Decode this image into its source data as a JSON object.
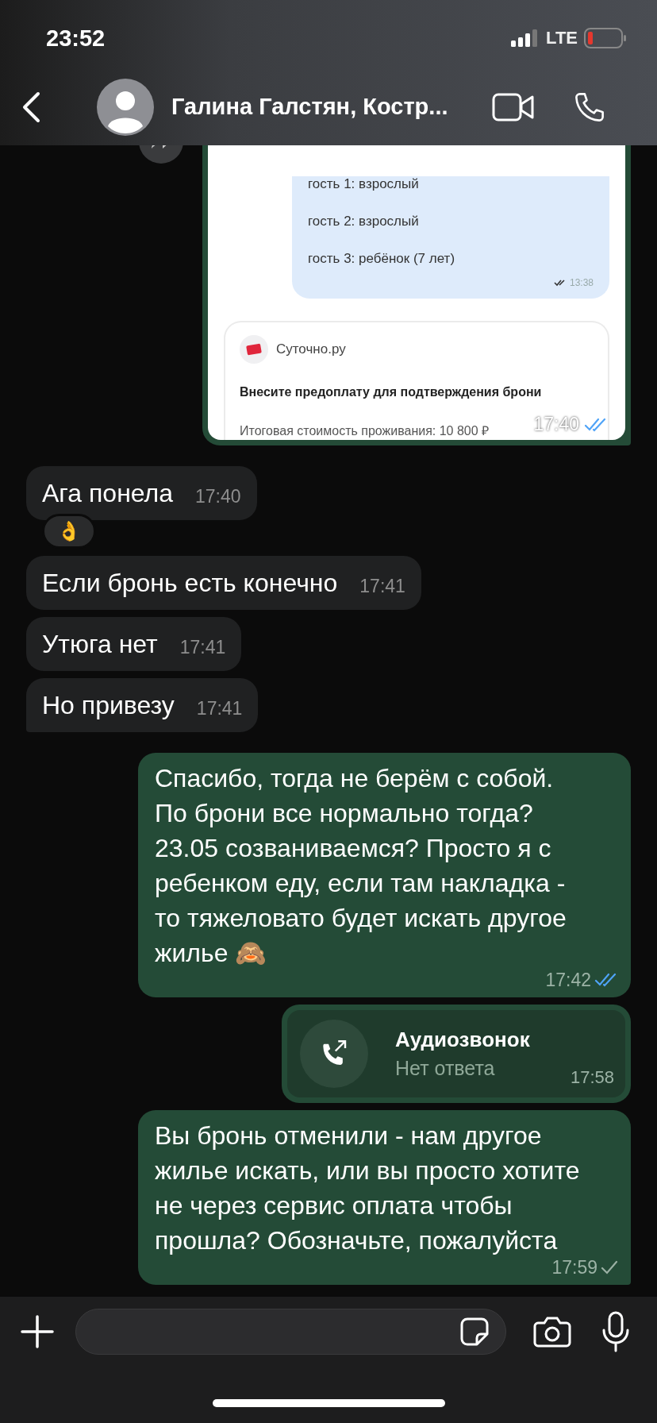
{
  "status_bar": {
    "time": "23:52",
    "network": "LTE"
  },
  "header": {
    "title": "Галина Галстян, Костр..."
  },
  "messages": [
    {
      "kind": "image",
      "outgoing": true,
      "tail": true,
      "time": "17:40",
      "read": true,
      "screenshot": {
        "bubble_lines": [
          "гость 1: взрослый",
          "гость 2: взрослый",
          "гость 3: ребёнок (7 лет)"
        ],
        "bubble_time": "13:38",
        "card": {
          "app": "Суточно.ру",
          "title": "Внесите предоплату для подтверждения брони",
          "total": "Итоговая стоимость проживания: 10 800 ₽"
        }
      }
    },
    {
      "kind": "text",
      "outgoing": false,
      "tail": false,
      "text": "Ага понела",
      "time": "17:40",
      "reaction": "👌"
    },
    {
      "kind": "text",
      "outgoing": false,
      "tail": false,
      "text": "Если бронь есть конечно",
      "time": "17:41"
    },
    {
      "kind": "text",
      "outgoing": false,
      "tail": false,
      "text": "Утюга нет",
      "time": "17:41"
    },
    {
      "kind": "text",
      "outgoing": false,
      "tail": true,
      "text": "Но привезу",
      "time": "17:41"
    },
    {
      "kind": "text",
      "outgoing": true,
      "tail": false,
      "text": "Спасибо, тогда не берём с собой.\nПо брони все нормально тогда?\n23.05 созваниваемся? Просто я с\nребенком еду, если там накладка -\nто тяжеловато будет искать другое\nжилье 🙈",
      "time": "17:42",
      "read": true
    },
    {
      "kind": "call",
      "outgoing": true,
      "tail": false,
      "title": "Аудиозвонок",
      "subtitle": "Нет ответа",
      "time": "17:58"
    },
    {
      "kind": "text",
      "outgoing": true,
      "tail": true,
      "text": "Вы бронь отменили - нам другое\nжилье искать, или вы просто хотите\nне через сервис оплата чтобы\nпрошла? Обозначьте, пожалуйста",
      "time": "17:59",
      "read": false
    }
  ],
  "composer": {
    "kind": "empty"
  }
}
